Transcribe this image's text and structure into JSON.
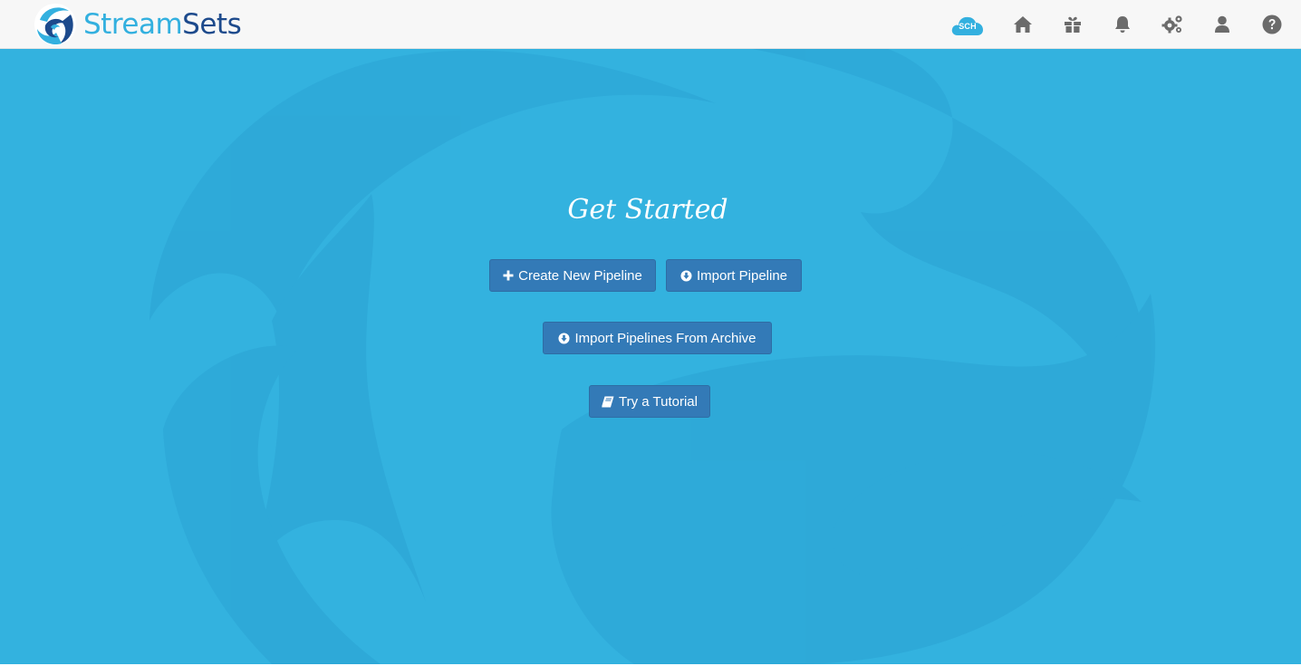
{
  "brand": {
    "name_part1": "Stream",
    "name_part2": "Sets"
  },
  "header": {
    "sch_label": "SCH",
    "icons": [
      "sch-cloud-icon",
      "home-icon",
      "gift-icon",
      "bell-icon",
      "gears-icon",
      "user-icon",
      "help-icon"
    ]
  },
  "main": {
    "title": "Get Started",
    "buttons": {
      "create_pipeline": "Create New Pipeline",
      "import_pipeline": "Import Pipeline",
      "import_archive": "Import Pipelines From Archive",
      "tutorial": "Try a Tutorial"
    }
  },
  "colors": {
    "brand_light": "#33b0df",
    "brand_dark": "#1d4a8c",
    "background": "#33b2df",
    "button": "#337ab7"
  }
}
